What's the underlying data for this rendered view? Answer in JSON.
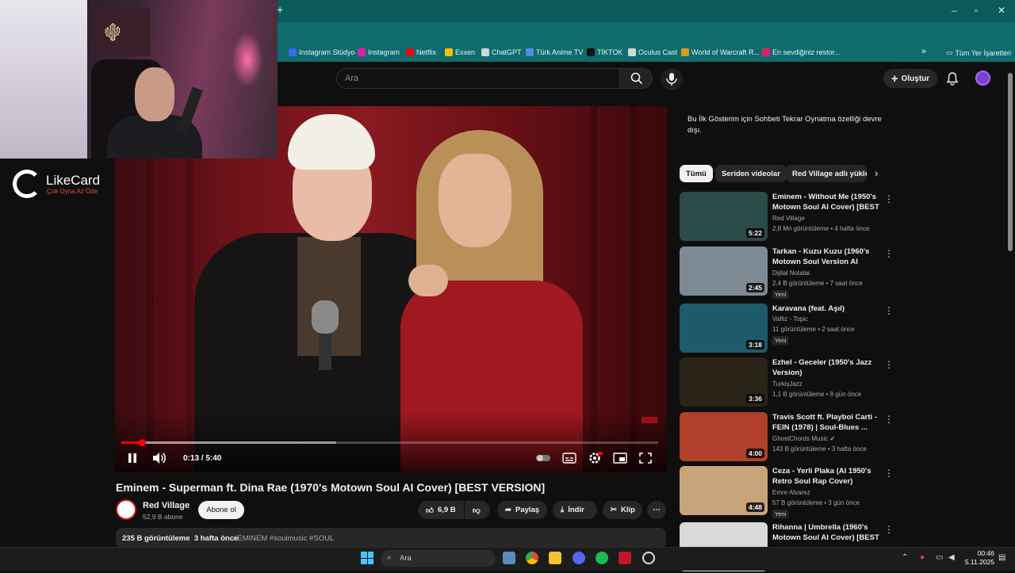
{
  "browser": {
    "bookmarks": [
      {
        "label": "Instagram Stüdyo",
        "color": "#3b6de0"
      },
      {
        "label": "Instagram",
        "color": "#d6249f"
      },
      {
        "label": "Netflix",
        "color": "#e50914"
      },
      {
        "label": "Exxen",
        "color": "#f2c200"
      },
      {
        "label": "ChatGPT",
        "color": "#cfd8d8"
      },
      {
        "label": "Türk Anime TV",
        "color": "#4a8fe0"
      },
      {
        "label": "TİKTOK",
        "color": "#111111"
      },
      {
        "label": "Oculus Cast",
        "color": "#cfd8d8"
      },
      {
        "label": "World of Warcraft R...",
        "color": "#d89a20"
      },
      {
        "label": "En sevdiğiniz restor...",
        "color": "#e0206a"
      }
    ],
    "all_bookmarks_label": "Tüm Yer İşaretleri",
    "new_tab_symbol": "+",
    "bookmarks_overflow": "»"
  },
  "overlay": {
    "brand": "LikeCard",
    "tagline": "Çok Oyna  Az Öde"
  },
  "header": {
    "search_placeholder": "Ara",
    "create_label": "Oluştur"
  },
  "player": {
    "time": "0:13 / 5:40",
    "progress": 0.038,
    "buffered": 0.4
  },
  "video": {
    "title": "Eminem - Superman ft. Dina Rae (1970's Motown Soul AI Cover) [BEST VERSION]",
    "channel": "Red Village",
    "subscribers": "52,9 B abone",
    "subscribe_label": "Abone ol",
    "likes": "6,9 B",
    "share_label": "Paylaş",
    "download_label": "İndir",
    "clip_label": "Klip",
    "views": "235 B görüntüleme",
    "age": "3 hafta önce",
    "hashtags": "#EMINEM #soulmusic #SOUL"
  },
  "sidebar": {
    "chat_note": "Bu İlk Gösterim için Sohbeti Tekrar Oynatma özelliği devre dışı.",
    "chips": [
      "Tümü",
      "Seriden videolar",
      "Red Village adlı yükle"
    ],
    "recommendations": [
      {
        "title": "Eminem - Without Me (1950's Motown Soul AI Cover) [BEST ...",
        "channel": "Red Village",
        "meta": "2,8 Mn görüntüleme • 4 hafta önce",
        "duration": "5:22",
        "badge": "",
        "color": "#2b4a48"
      },
      {
        "title": "Tarkan - Kuzu Kuzu (1960's Motown Soul Version AI Cover...",
        "channel": "Dijital Notalar.",
        "meta": "2,4 B görüntüleme • 7 saat önce",
        "duration": "2:45",
        "badge": "Yeni",
        "color": "#7d8a94"
      },
      {
        "title": "Karavana (feat. Aşıl)",
        "channel": "Vaftiz - Topic",
        "meta": "11 görüntüleme • 2 saat önce",
        "duration": "3:18",
        "badge": "Yeni",
        "color": "#1d5a6a"
      },
      {
        "title": "Ezhel - Geceler (1950's Jazz Version)",
        "channel": "TurkişJazz",
        "meta": "1,1 B görüntüleme • 8 gün önce",
        "duration": "3:36",
        "badge": "",
        "color": "#2a2418"
      },
      {
        "title": "Travis Scott ft. Playboi Carti - FEIN (1978) | Soul-Blues ...",
        "channel": "GhostChords Music ✔",
        "meta": "143 B görüntüleme • 3 hafta önce",
        "duration": "4:00",
        "badge": "",
        "color": "#b0402a"
      },
      {
        "title": "Ceza - Yerli Plaka (AI 1950's Retro Soul Rap Cover)",
        "channel": "Emre Alvarez",
        "meta": "57 B görüntüleme • 3 gün önce",
        "duration": "4:48",
        "badge": "Yeni",
        "color": "#c8a47a"
      },
      {
        "title": "Rihanna | Umbrella (1960's Motown Soul AI Cover) [BEST ...",
        "channel": "",
        "meta": "",
        "duration": "",
        "badge": "",
        "color": "#d9d9d9"
      }
    ]
  },
  "taskbar": {
    "search_label": "Ara",
    "time": "00:46",
    "date": "5.11.2025"
  }
}
